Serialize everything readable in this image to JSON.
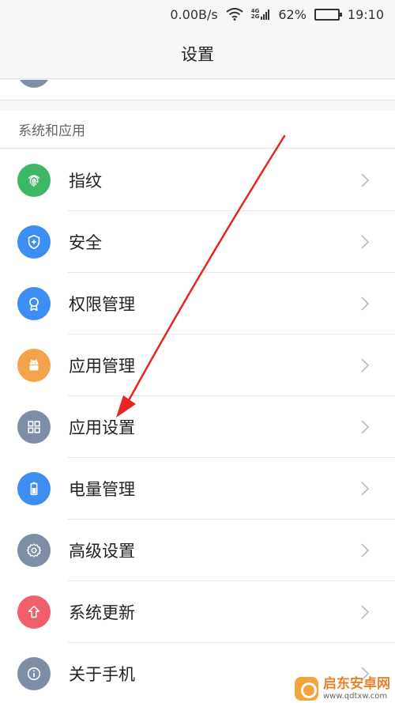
{
  "status_bar": {
    "speed": "0.00B/s",
    "net_4g": "4G",
    "net_2g": "2G",
    "battery_pct": "62%",
    "battery_level": 0.62,
    "time": "19:10"
  },
  "header": {
    "title": "设置"
  },
  "section": {
    "title": "系统和应用"
  },
  "items": [
    {
      "label": "指纹",
      "icon": "fingerprint-icon",
      "color": "#3cb764"
    },
    {
      "label": "安全",
      "icon": "shield-icon",
      "color": "#3d8ef2"
    },
    {
      "label": "权限管理",
      "icon": "badge-icon",
      "color": "#3d8ef2"
    },
    {
      "label": "应用管理",
      "icon": "android-icon",
      "color": "#f3a44b"
    },
    {
      "label": "应用设置",
      "icon": "grid-icon",
      "color": "#7e8ea6"
    },
    {
      "label": "电量管理",
      "icon": "battery-icon",
      "color": "#3d8ef2"
    },
    {
      "label": "高级设置",
      "icon": "gear-icon",
      "color": "#7e8ea6"
    },
    {
      "label": "系统更新",
      "icon": "upload-arrow-icon",
      "color": "#f05f6a"
    },
    {
      "label": "关于手机",
      "icon": "info-icon",
      "color": "#7e8ea6"
    }
  ],
  "watermark": {
    "name": "启东安卓网",
    "url": "www.qdtxw.com"
  }
}
